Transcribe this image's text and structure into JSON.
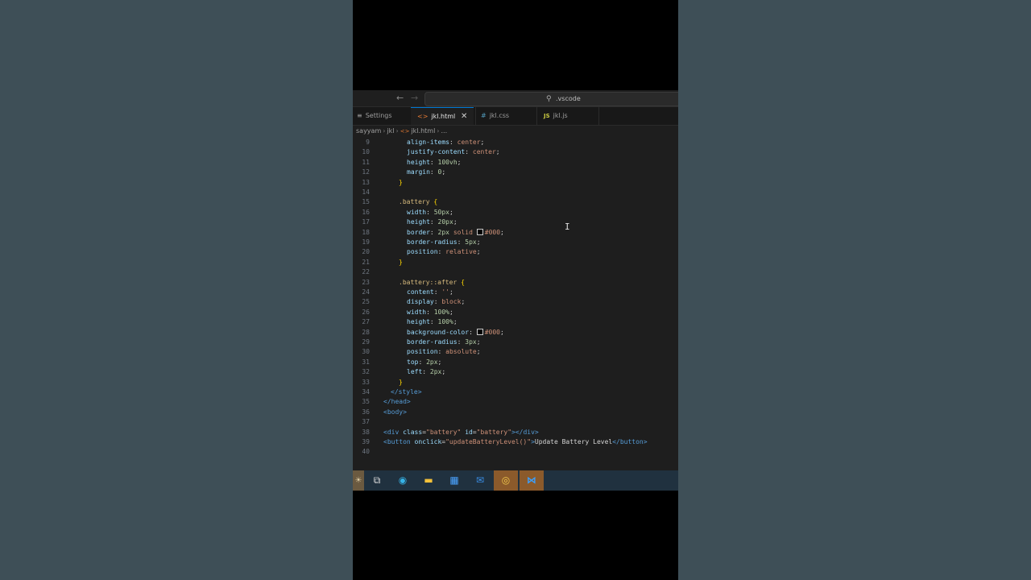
{
  "titlebar": {
    "back": "←",
    "forward": "→",
    "search_icon": "⚲",
    "search_text": ".vscode"
  },
  "tabs": [
    {
      "icon": "≡",
      "label": "Settings"
    },
    {
      "icon": "<>",
      "label": "jkl.html",
      "close": "✕"
    },
    {
      "icon": "#",
      "label": "jkl.css"
    },
    {
      "icon": "JS",
      "label": "jkl.js"
    }
  ],
  "breadcrumb": {
    "root": "sayyam",
    "folder": "jkl",
    "file_icon": "<>",
    "file": "jkl.html",
    "more": "..."
  },
  "lines": [
    {
      "n": "9"
    },
    {
      "n": "10"
    },
    {
      "n": "11"
    },
    {
      "n": "12"
    },
    {
      "n": "13"
    },
    {
      "n": "14"
    },
    {
      "n": "15"
    },
    {
      "n": "16"
    },
    {
      "n": "17"
    },
    {
      "n": "18"
    },
    {
      "n": "19"
    },
    {
      "n": "20"
    },
    {
      "n": "21"
    },
    {
      "n": "22"
    },
    {
      "n": "23"
    },
    {
      "n": "24"
    },
    {
      "n": "25"
    },
    {
      "n": "26"
    },
    {
      "n": "27"
    },
    {
      "n": "28"
    },
    {
      "n": "29"
    },
    {
      "n": "30"
    },
    {
      "n": "31"
    },
    {
      "n": "32"
    },
    {
      "n": "33"
    },
    {
      "n": "34"
    },
    {
      "n": "35"
    },
    {
      "n": "36"
    },
    {
      "n": "37"
    },
    {
      "n": "38"
    },
    {
      "n": "39"
    },
    {
      "n": "40"
    }
  ],
  "code": {
    "l9": {
      "prop": "align-items",
      "val": "center"
    },
    "l10": {
      "prop": "justify-content",
      "val": "center"
    },
    "l11": {
      "prop": "height",
      "val": "100vh"
    },
    "l12": {
      "prop": "margin",
      "val": "0"
    },
    "l13": {
      "brace": "}"
    },
    "l15": {
      "selector": ".battery",
      "brace": "{"
    },
    "l16": {
      "prop": "width",
      "val": "50px"
    },
    "l17": {
      "prop": "height",
      "val": "20px"
    },
    "l18": {
      "prop": "border",
      "val1": "2px",
      "val2": "solid",
      "val3": "#000"
    },
    "l19": {
      "prop": "border-radius",
      "val": "5px"
    },
    "l20": {
      "prop": "position",
      "val": "relative"
    },
    "l21": {
      "brace": "}"
    },
    "l23": {
      "selector": ".battery::after",
      "brace": "{"
    },
    "l24": {
      "prop": "content",
      "val": "''"
    },
    "l25": {
      "prop": "display",
      "val": "block"
    },
    "l26": {
      "prop": "width",
      "val": "100%"
    },
    "l27": {
      "prop": "height",
      "val": "100%"
    },
    "l28": {
      "prop": "background-color",
      "val": "#000"
    },
    "l29": {
      "prop": "border-radius",
      "val": "3px"
    },
    "l30": {
      "prop": "position",
      "val": "absolute"
    },
    "l31": {
      "prop": "top",
      "val": "2px"
    },
    "l32": {
      "prop": "left",
      "val": "2px"
    },
    "l33": {
      "brace": "}"
    },
    "l34": {
      "tag": "</style>"
    },
    "l35": {
      "tag": "</head>"
    },
    "l36": {
      "tag": "<body>"
    },
    "l38": {
      "open": "<div",
      "attr1": "class",
      "val1": "\"battery\"",
      "attr2": "id",
      "val2": "\"battery\"",
      "close": "></div>"
    },
    "l39": {
      "open": "<button",
      "attr": "onclick",
      "val": "\"updateBatteryLevel()\"",
      "gt": ">",
      "text": "Update Battery Level",
      "close": "</button>"
    }
  },
  "taskbar": [
    {
      "name": "widgets",
      "glyph": "☀"
    },
    {
      "name": "task-view",
      "glyph": "⧉"
    },
    {
      "name": "edge",
      "glyph": "◉"
    },
    {
      "name": "file-explorer",
      "glyph": "▬"
    },
    {
      "name": "store",
      "glyph": "▦"
    },
    {
      "name": "mail",
      "glyph": "✉"
    },
    {
      "name": "chrome",
      "glyph": "◎"
    },
    {
      "name": "vscode",
      "glyph": "⋈"
    }
  ],
  "colors": {
    "accent": "#0078d4",
    "editor_bg": "#1e1e1e",
    "page_bg": "#3f5058"
  }
}
